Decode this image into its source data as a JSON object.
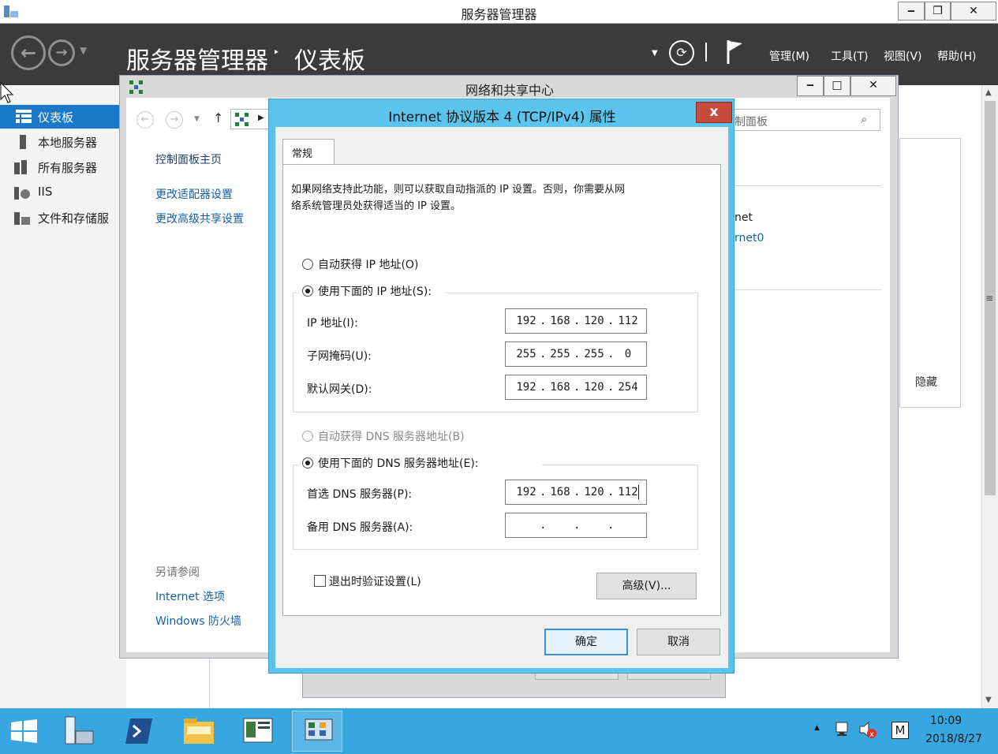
{
  "server_manager": {
    "window_title": "服务器管理器",
    "breadcrumb_title": "服务器管理器",
    "breadcrumb_sep": "‣",
    "breadcrumb_page": "仪表板",
    "menus": [
      "管理(M)",
      "工具(T)",
      "视图(V)",
      "帮助(H)"
    ],
    "nav": [
      {
        "label": "仪表板",
        "icon": "dashboard-icon",
        "active": true
      },
      {
        "label": "本地服务器",
        "icon": "server-icon",
        "active": false
      },
      {
        "label": "所有服务器",
        "icon": "servers-icon",
        "active": false
      },
      {
        "label": "IIS",
        "icon": "iis-icon",
        "active": false
      },
      {
        "label": "文件和存储服",
        "icon": "storage-icon",
        "active": false
      }
    ],
    "hide_label": "隐藏"
  },
  "nsc": {
    "title": "网络和共享中心",
    "search_placeholder": "制面板",
    "links": {
      "home": "控制面板主页",
      "adapter": "更改适配器设置",
      "sharing": "更改高级共享设置"
    },
    "see_also": "另请参阅",
    "see_also_links": [
      "Internet 选项",
      "Windows 防火墙"
    ],
    "partial_text1": "net",
    "partial_text2": "rnet0"
  },
  "dialog": {
    "title": "Internet 协议版本 4 (TCP/IPv4) 属性",
    "close": "x",
    "tab": "常规",
    "description_line1": "如果网络支持此功能，则可以获取自动指派的 IP 设置。否则，你需要从网",
    "description_line2": "络系统管理员处获得适当的 IP 设置。",
    "radio_auto_ip": "自动获得 IP 地址(O)",
    "radio_manual_ip": "使用下面的 IP 地址(S):",
    "ip_label": "IP 地址(I):",
    "ip_value": [
      "192",
      "168",
      "120",
      "112"
    ],
    "mask_label": "子网掩码(U):",
    "mask_value": [
      "255",
      "255",
      "255",
      "0"
    ],
    "gateway_label": "默认网关(D):",
    "gateway_value": [
      "192",
      "168",
      "120",
      "254"
    ],
    "radio_auto_dns": "自动获得 DNS 服务器地址(B)",
    "radio_manual_dns": "使用下面的 DNS 服务器地址(E):",
    "pref_dns_label": "首选 DNS 服务器(P):",
    "pref_dns_value": [
      "192",
      "168",
      "120",
      "112"
    ],
    "alt_dns_label": "备用 DNS 服务器(A):",
    "alt_dns_value": [
      "",
      "",
      "",
      ""
    ],
    "validate_label": "退出时验证设置(L)",
    "advanced_button": "高级(V)...",
    "ok_button": "确定",
    "cancel_button": "取消"
  },
  "taskbar": {
    "time": "10:09",
    "date": "2018/8/27",
    "ime": "M"
  }
}
